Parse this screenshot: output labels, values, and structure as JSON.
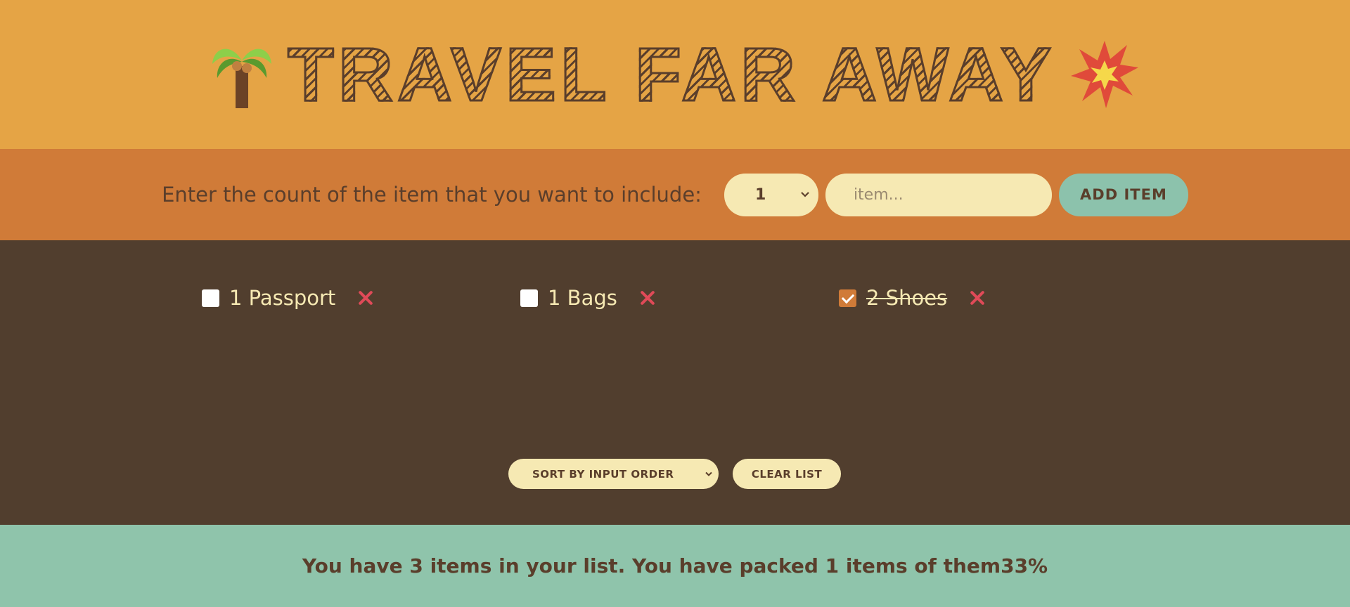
{
  "header": {
    "title": "TRAVEL FAR AWAY",
    "left_icon": "palm-tree-icon",
    "right_icon": "collision-icon"
  },
  "add_form": {
    "label": "Enter the count of the item that you want to include:",
    "quantity_value": "1",
    "item_placeholder": "item...",
    "add_button_label": "ADD ITEM"
  },
  "items": [
    {
      "text": "1 Passport",
      "packed": false
    },
    {
      "text": "1 Bags",
      "packed": false
    },
    {
      "text": "2 Shoes",
      "packed": true
    }
  ],
  "actions": {
    "sort_value": "SORT BY INPUT ORDER",
    "clear_label": "CLEAR LIST"
  },
  "stats": {
    "text": "You have 3 items in your list. You have packed 1 items of them33%"
  },
  "colors": {
    "header_bg": "#e5a445",
    "form_bg": "#d07b38",
    "list_bg": "#513e2e",
    "stats_bg": "#8fc4ab",
    "text_dark": "#5a3e2b",
    "text_light": "#f6e9b3",
    "delete": "#e04a58"
  }
}
